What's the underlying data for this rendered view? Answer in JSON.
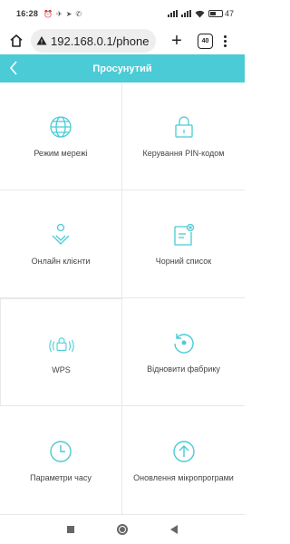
{
  "status_bar": {
    "time": "16:28",
    "left_icons": [
      "alarm-icon",
      "signal-arrow-icon",
      "telegram-icon",
      "viber-icon"
    ],
    "battery": "47"
  },
  "browser": {
    "url": "192.168.0.1/phone",
    "tab_count": "40"
  },
  "header": {
    "title": "Просунутий"
  },
  "grid": [
    {
      "label": "Режим мережі",
      "icon": "globe-icon"
    },
    {
      "label": "Керування PIN-кодом",
      "icon": "lock-icon"
    },
    {
      "label": "Онлайн клієнти",
      "icon": "clients-icon"
    },
    {
      "label": "Чорний список",
      "icon": "blacklist-icon"
    },
    {
      "label": "WPS",
      "icon": "wps-icon"
    },
    {
      "label": "Відновити фабрику",
      "icon": "restore-icon"
    },
    {
      "label": "Параметри часу",
      "icon": "clock-icon"
    },
    {
      "label": "Оновлення мікропрограми",
      "icon": "upgrade-icon"
    }
  ],
  "colors": {
    "accent": "#4acbd6",
    "icon": "#4acbd6"
  }
}
